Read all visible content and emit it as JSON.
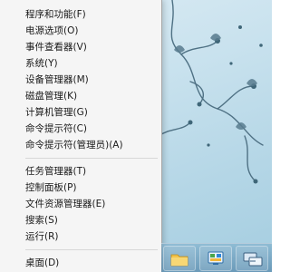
{
  "context_menu": {
    "group1": [
      {
        "label": "程序和功能(F)"
      },
      {
        "label": "电源选项(O)"
      },
      {
        "label": "事件查看器(V)"
      },
      {
        "label": "系统(Y)"
      },
      {
        "label": "设备管理器(M)"
      },
      {
        "label": "磁盘管理(K)"
      },
      {
        "label": "计算机管理(G)"
      },
      {
        "label": "命令提示符(C)"
      },
      {
        "label": "命令提示符(管理员)(A)"
      }
    ],
    "group2": [
      {
        "label": "任务管理器(T)"
      },
      {
        "label": "控制面板(P)"
      },
      {
        "label": "文件资源管理器(E)"
      },
      {
        "label": "搜索(S)"
      },
      {
        "label": "运行(R)"
      }
    ],
    "group3": [
      {
        "label": "桌面(D)"
      }
    ]
  },
  "taskbar": {
    "buttons": [
      {
        "icon": "folder-icon"
      },
      {
        "icon": "control-panel-icon"
      },
      {
        "icon": "network-icon"
      }
    ]
  },
  "colors": {
    "menu_bg": "#f5f5f5",
    "desktop_bg": "#c9e2ee",
    "vine": "#4f7184"
  }
}
